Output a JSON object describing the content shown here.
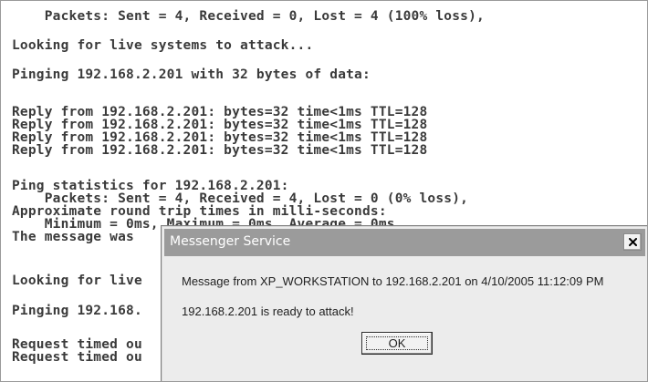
{
  "console": {
    "lines": [
      "    Packets: Sent = 4, Received = 0, Lost = 4 (100% loss),",
      "Looking for live systems to attack...",
      "Pinging 192.168.2.201 with 32 bytes of data:",
      "Reply from 192.168.2.201: bytes=32 time<1ms TTL=128",
      "Reply from 192.168.2.201: bytes=32 time<1ms TTL=128",
      "Reply from 192.168.2.201: bytes=32 time<1ms TTL=128",
      "Reply from 192.168.2.201: bytes=32 time<1ms TTL=128",
      "Ping statistics for 192.168.2.201:",
      "    Packets: Sent = 4, Received = 4, Lost = 0 (0% loss),",
      "Approximate round trip times in milli-seconds:",
      "    Minimum = 0ms, Maximum = 0ms, Average = 0ms",
      "The message was",
      "Looking for live",
      "Pinging 192.168.",
      "Request timed ou",
      "Request timed ou"
    ]
  },
  "dialog": {
    "title": "Messenger Service",
    "message": "Message from XP_WORKSTATION to 192.168.2.201 on 4/10/2005 11:12:09 PM",
    "body": "192.168.2.201 is ready to attack!",
    "ok_label": "OK",
    "close_icon": "close-x-icon"
  }
}
